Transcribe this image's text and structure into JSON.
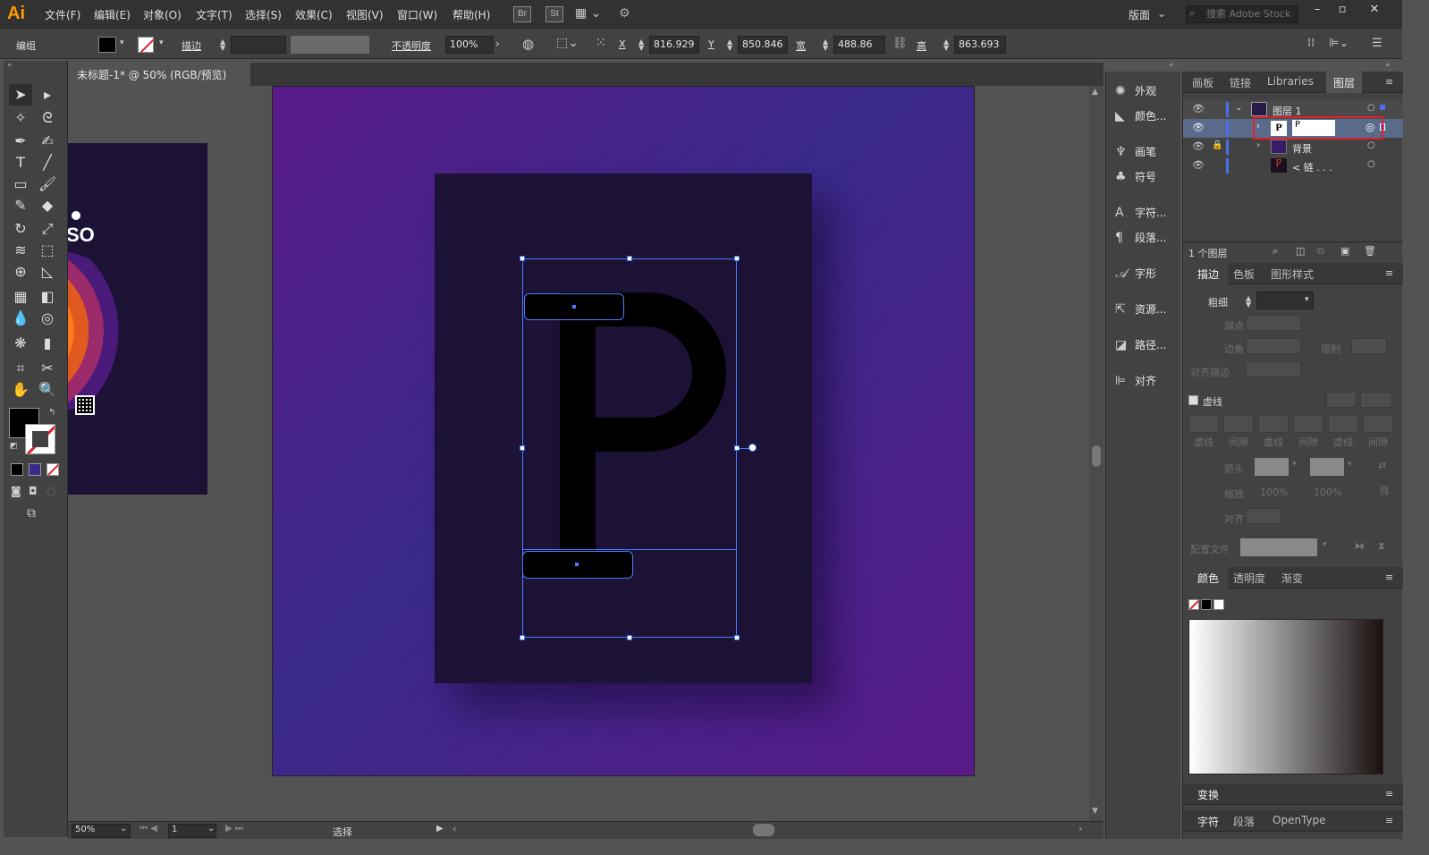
{
  "app": {
    "logo": "Ai",
    "menus": [
      "文件(F)",
      "编辑(E)",
      "对象(O)",
      "文字(T)",
      "选择(S)",
      "效果(C)",
      "视图(V)",
      "窗口(W)",
      "帮助(H)"
    ],
    "bridge": "Br",
    "stock": "St",
    "workspace": "版面",
    "search_placeholder": "搜索 Adobe Stock"
  },
  "control": {
    "mode": "编组",
    "stroke_label": "描边",
    "opacity_label": "不透明度",
    "opacity": "100%",
    "x_label": "X",
    "x": "816.929",
    "y_label": "Y",
    "y": "850.846",
    "w_label": "宽",
    "w": "488.86",
    "h_label": "高",
    "h": "863.693"
  },
  "document": {
    "tab_title": "未标题-1* @ 50% (RGB/预览)",
    "close": "×",
    "glyph": "P",
    "side_text": "SO"
  },
  "status": {
    "zoom": "50%",
    "page": "1",
    "tool_name": "选择"
  },
  "icon_panel": [
    "外观",
    "颜色...",
    "画笔",
    "符号",
    "字符...",
    "段落...",
    "字形",
    "资源...",
    "路径...",
    "对齐"
  ],
  "layers_panel": {
    "tabs": [
      "画板",
      "链接",
      "Libraries",
      "图层"
    ],
    "rows": [
      {
        "name": "图层 1"
      },
      {
        "name": "P"
      },
      {
        "name": "背景"
      },
      {
        "name": "< 链 . . ."
      }
    ],
    "count": "1 个图层"
  },
  "stroke_panel": {
    "tabs": [
      "描边",
      "色板",
      "图形样式"
    ],
    "weight_label": "粗细",
    "cap_label": "端点",
    "corner_label": "边角",
    "limit_label": "限制",
    "align_label": "对齐描边",
    "dash_label": "虚线",
    "dash_cells": [
      "虚线",
      "间隙",
      "虚线",
      "间隙",
      "虚线",
      "间隙"
    ],
    "arrow_label": "箭头",
    "scale_label": "缩放",
    "scale1": "100%",
    "scale2": "100%",
    "align2_label": "对齐",
    "profile_label": "配置文件"
  },
  "color_panel": {
    "tabs": [
      "颜色",
      "透明度",
      "渐变"
    ]
  },
  "transform_panel": {
    "title": "变换"
  },
  "char_panel": {
    "tabs": [
      "字符",
      "段落",
      "OpenType"
    ]
  },
  "colors": {
    "highlight_box": "#e0202a",
    "selection": "#4a7cff",
    "layer_color": "#4a6cf0"
  }
}
